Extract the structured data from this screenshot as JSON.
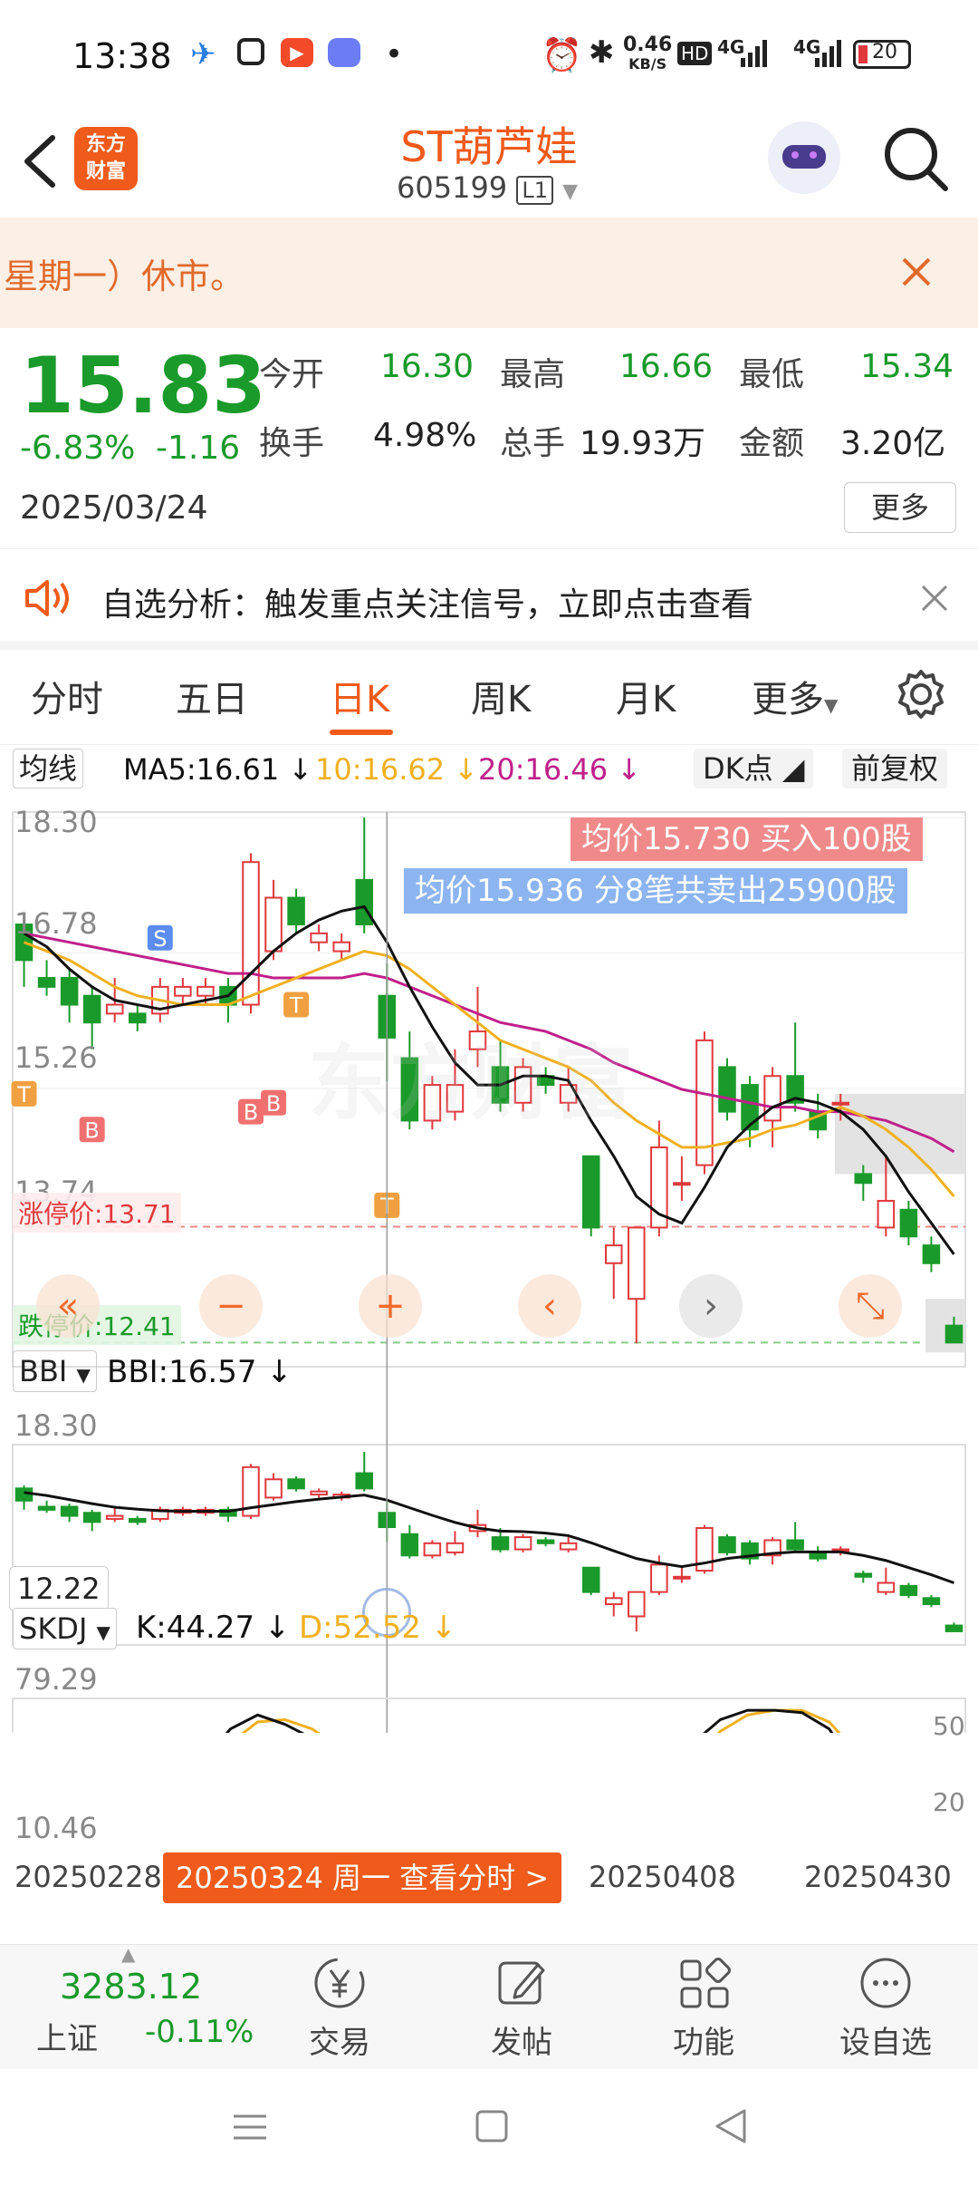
{
  "status": {
    "time": "13:38",
    "net_speed": "0.46",
    "net_unit": "KB/S",
    "hd_label": "HD",
    "battery": "20",
    "signal1": "4G",
    "signal2": "4G"
  },
  "header": {
    "logo_text": "东方财富",
    "stock_name": "ST葫芦娃",
    "stock_code": "605199",
    "level_badge": "L1"
  },
  "notice": {
    "text": "星期一）休市。"
  },
  "quote": {
    "price": "15.83",
    "change_pct": "-6.83%",
    "change": "-1.16",
    "date": "2025/03/24",
    "fields": [
      {
        "label": "今开",
        "value": "16.30"
      },
      {
        "label": "最高",
        "value": "16.66"
      },
      {
        "label": "最低",
        "value": "15.34"
      },
      {
        "label": "换手",
        "value": "4.98%"
      },
      {
        "label": "总手",
        "value": "19.93万"
      },
      {
        "label": "金额",
        "value": "3.20亿"
      }
    ],
    "more_button": "更多",
    "colors": {
      "down": "#1a9a2a",
      "up": "#e0383c"
    }
  },
  "alert": {
    "text": "自选分析：触发重点关注信号，立即点击查看"
  },
  "tabs": [
    "分时",
    "五日",
    "日K",
    "周K",
    "月K",
    "更多"
  ],
  "active_tab": "日K",
  "kline": {
    "ma_selector": "均线",
    "ma5": "MA5:16.61",
    "ma10": "10:16.62",
    "ma20": "20:16.46",
    "dk_button": "DK点",
    "fq_button": "前复权",
    "ticks": [
      "18.30",
      "16.78",
      "15.26",
      "13.74"
    ],
    "buy_banner": "均价15.730  买入100股",
    "sell_banner": "均价15.936  分8笔共卖出25900股",
    "limit_up": "涨停价:13.71",
    "limit_down": "跌停价:12.41",
    "marker_s": "S",
    "marker_b": "B",
    "marker_t": "T",
    "watermark": "东方财富"
  },
  "bbi": {
    "selector": "BBI",
    "value": "BBI:16.57",
    "tick_top": "18.30",
    "crosshair_value": "12.22"
  },
  "skdj": {
    "selector": "SKDJ",
    "k": "K:44.27",
    "d": "D:52.52",
    "tick_top": "79.29",
    "tick_bottom": "10.46",
    "ref50": "50",
    "ref20": "20"
  },
  "xaxis": {
    "left": "20250228",
    "mid": "20250408",
    "right": "20250430",
    "tooltip": "20250324 周一 查看分时 >"
  },
  "chart_data": {
    "type": "candlestick",
    "ylim": [
      12.41,
      18.3
    ],
    "candles": [
      {
        "o": 17.1,
        "c": 16.7,
        "h": 17.2,
        "l": 16.4
      },
      {
        "o": 16.5,
        "c": 16.4,
        "h": 16.7,
        "l": 16.3
      },
      {
        "o": 16.5,
        "c": 16.2,
        "h": 16.6,
        "l": 16.0
      },
      {
        "o": 16.3,
        "c": 16.0,
        "h": 16.4,
        "l": 15.7
      },
      {
        "o": 16.1,
        "c": 16.2,
        "h": 16.5,
        "l": 16.0
      },
      {
        "o": 16.1,
        "c": 16.0,
        "h": 16.2,
        "l": 15.9
      },
      {
        "o": 16.1,
        "c": 16.4,
        "h": 16.5,
        "l": 16.0
      },
      {
        "o": 16.3,
        "c": 16.4,
        "h": 16.5,
        "l": 16.2
      },
      {
        "o": 16.3,
        "c": 16.4,
        "h": 16.5,
        "l": 16.2
      },
      {
        "o": 16.4,
        "c": 16.2,
        "h": 16.5,
        "l": 16.0
      },
      {
        "o": 16.2,
        "c": 17.8,
        "h": 17.9,
        "l": 16.1
      },
      {
        "o": 16.8,
        "c": 17.4,
        "h": 17.6,
        "l": 16.7
      },
      {
        "o": 17.4,
        "c": 17.1,
        "h": 17.5,
        "l": 17.0
      },
      {
        "o": 16.9,
        "c": 17.0,
        "h": 17.1,
        "l": 16.8
      },
      {
        "o": 16.8,
        "c": 16.9,
        "h": 17.0,
        "l": 16.7
      },
      {
        "o": 17.6,
        "c": 17.1,
        "h": 18.3,
        "l": 17.0
      },
      {
        "o": 16.3,
        "c": 15.83,
        "h": 16.66,
        "l": 15.34
      },
      {
        "o": 15.6,
        "c": 14.9,
        "h": 15.9,
        "l": 14.8
      },
      {
        "o": 14.9,
        "c": 15.3,
        "h": 15.4,
        "l": 14.8
      },
      {
        "o": 15.0,
        "c": 15.3,
        "h": 15.7,
        "l": 14.9
      },
      {
        "o": 15.7,
        "c": 15.9,
        "h": 16.4,
        "l": 15.5
      },
      {
        "o": 15.5,
        "c": 15.1,
        "h": 15.8,
        "l": 15.0
      },
      {
        "o": 15.1,
        "c": 15.5,
        "h": 15.6,
        "l": 15.0
      },
      {
        "o": 15.4,
        "c": 15.3,
        "h": 15.5,
        "l": 15.2
      },
      {
        "o": 15.1,
        "c": 15.3,
        "h": 15.5,
        "l": 15.0
      },
      {
        "o": 14.5,
        "c": 13.7,
        "h": 14.5,
        "l": 13.6
      },
      {
        "o": 13.3,
        "c": 13.5,
        "h": 13.7,
        "l": 12.9
      },
      {
        "o": 12.9,
        "c": 13.7,
        "h": 13.7,
        "l": 12.4
      },
      {
        "o": 13.7,
        "c": 14.6,
        "h": 14.9,
        "l": 13.6
      },
      {
        "o": 14.2,
        "c": 14.2,
        "h": 14.5,
        "l": 14.0
      },
      {
        "o": 14.4,
        "c": 15.8,
        "h": 15.9,
        "l": 14.3
      },
      {
        "o": 15.5,
        "c": 15.0,
        "h": 15.6,
        "l": 14.9
      },
      {
        "o": 15.3,
        "c": 14.8,
        "h": 15.4,
        "l": 14.6
      },
      {
        "o": 14.9,
        "c": 15.4,
        "h": 15.5,
        "l": 14.6
      },
      {
        "o": 15.4,
        "c": 15.1,
        "h": 16.0,
        "l": 15.0
      },
      {
        "o": 15.0,
        "c": 14.8,
        "h": 15.2,
        "l": 14.7
      },
      {
        "o": 15.1,
        "c": 15.1,
        "h": 15.2,
        "l": 14.9
      },
      {
        "o": 14.3,
        "c": 14.2,
        "h": 14.4,
        "l": 14.0
      },
      {
        "o": 13.7,
        "c": 14.0,
        "h": 14.5,
        "l": 13.6
      },
      {
        "o": 13.9,
        "c": 13.6,
        "h": 14.0,
        "l": 13.5
      },
      {
        "o": 13.5,
        "c": 13.3,
        "h": 13.6,
        "l": 13.2
      },
      {
        "o": 12.6,
        "c": 12.41,
        "h": 12.7,
        "l": 12.41
      }
    ],
    "ma5": [
      17.0,
      16.85,
      16.6,
      16.4,
      16.25,
      16.2,
      16.15,
      16.2,
      16.25,
      16.3,
      16.55,
      16.8,
      17.0,
      17.15,
      17.25,
      17.3,
      16.9,
      16.4,
      15.95,
      15.55,
      15.3,
      15.3,
      15.4,
      15.4,
      15.35,
      14.9,
      14.5,
      14.05,
      13.85,
      13.75,
      14.15,
      14.6,
      14.85,
      15.05,
      15.15,
      15.1,
      15.0,
      14.8,
      14.5,
      14.1,
      13.75,
      13.4
    ],
    "ma10": [
      16.9,
      16.8,
      16.7,
      16.55,
      16.4,
      16.3,
      16.25,
      16.2,
      16.2,
      16.2,
      16.3,
      16.4,
      16.5,
      16.6,
      16.7,
      16.8,
      16.75,
      16.6,
      16.4,
      16.2,
      16.0,
      15.8,
      15.7,
      15.6,
      15.5,
      15.35,
      15.1,
      14.9,
      14.75,
      14.6,
      14.6,
      14.65,
      14.7,
      14.8,
      14.85,
      14.95,
      15.05,
      14.95,
      14.8,
      14.6,
      14.35,
      14.05
    ],
    "ma20": [
      17.0,
      16.95,
      16.9,
      16.85,
      16.8,
      16.75,
      16.7,
      16.65,
      16.6,
      16.55,
      16.55,
      16.5,
      16.5,
      16.5,
      16.5,
      16.55,
      16.5,
      16.4,
      16.3,
      16.2,
      16.1,
      16.0,
      15.95,
      15.9,
      15.8,
      15.7,
      15.55,
      15.45,
      15.35,
      15.25,
      15.2,
      15.15,
      15.1,
      15.05,
      15.05,
      15.0,
      15.0,
      14.95,
      14.9,
      14.8,
      14.7,
      14.55
    ],
    "skdj_k": [
      12,
      12,
      13,
      17,
      22,
      26,
      36,
      58,
      72,
      78,
      74,
      68,
      58,
      40,
      22,
      16,
      18,
      16,
      13,
      12,
      11,
      12,
      20,
      35,
      52,
      66,
      76,
      80,
      80,
      79,
      72,
      54,
      36,
      20,
      13,
      9
    ],
    "skdj_d": [
      12,
      12,
      12,
      15,
      18,
      24,
      31,
      48,
      66,
      75,
      76,
      72,
      64,
      48,
      32,
      22,
      17,
      16,
      14,
      12,
      11,
      11,
      15,
      26,
      42,
      58,
      71,
      78,
      80,
      80,
      75,
      62,
      46,
      30,
      19,
      13
    ]
  }
}
